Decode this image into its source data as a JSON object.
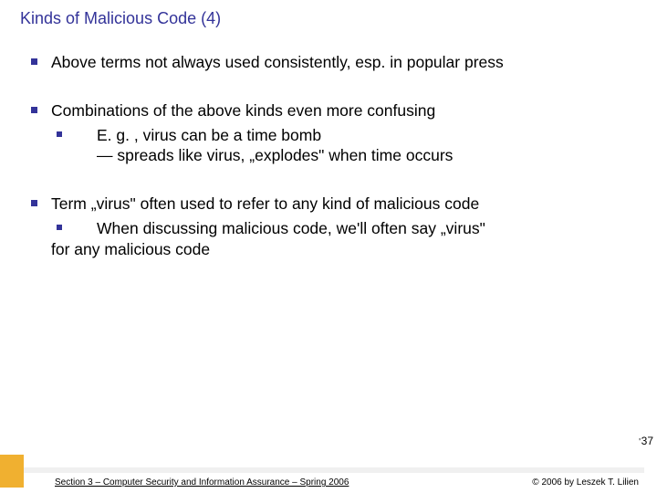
{
  "title": "Kinds of Malicious Code (4)",
  "bullets": {
    "b1": "Above terms not always used consistently, esp. in popular press",
    "b2": "Combinations of the above kinds even more confusing",
    "b2sub1": "E. g. , virus can be a time bomb",
    "b2sub2": "— spreads like virus, „explodes\" when time occurs",
    "b3": "Term „virus\" often used to refer to any kind of malicious code",
    "b3sub1a": "When discussing malicious code, we'll often say „virus\"",
    "b3sub1b": "for any malicious code"
  },
  "footer": {
    "left": "Section 3 – Computer Security and Information Assurance – Spring 2006",
    "right": "© 2006 by Leszek T. Lilien"
  },
  "page": "37"
}
